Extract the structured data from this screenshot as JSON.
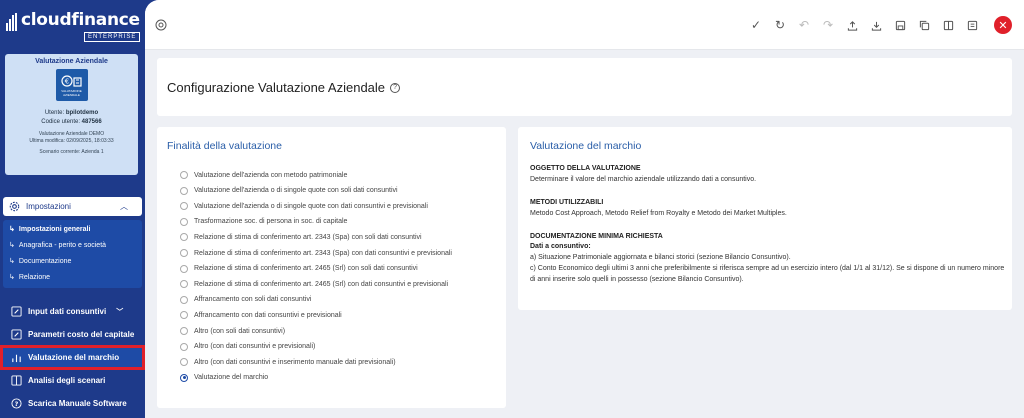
{
  "brand": {
    "name": "cloudfinance",
    "edition": "ENTERPRISE"
  },
  "card": {
    "title": "Valutazione Aziendale",
    "image_label": "VALUTAZIONE AZIENDALE",
    "user_label": "Utente:",
    "user_value": "bpilotdemo",
    "code_label": "Codice utente:",
    "code_value": "487566",
    "company": "Valutazione Aziendale DEMO",
    "last_modified": "Ultima modifica: 02/09/2025, 18:03:33",
    "scenario": "Scenario corrente: Azienda 1"
  },
  "sidebar": {
    "section": "Impostazioni",
    "sub_items": [
      {
        "label": "Impostazioni generali"
      },
      {
        "label": "Anagrafica - perito e società"
      },
      {
        "label": "Documentazione"
      },
      {
        "label": "Relazione"
      }
    ],
    "nav": [
      {
        "label": "Input dati consuntivi"
      },
      {
        "label": "Parametri costo del capitale"
      },
      {
        "label": "Valutazione del marchio"
      },
      {
        "label": "Analisi degli scenari"
      },
      {
        "label": "Scarica Manuale Software"
      }
    ]
  },
  "toolbar": {
    "left_icon": "lifebuoy-icon",
    "icons": [
      "check-icon",
      "refresh-icon",
      "undo-icon",
      "redo-icon",
      "upload-icon",
      "download-icon",
      "save-icon",
      "copy-icon",
      "columns-icon",
      "document-icon"
    ],
    "close_color": "#e0202a"
  },
  "page": {
    "title": "Configurazione Valutazione Aziendale"
  },
  "finalita": {
    "title": "Finalità della valutazione",
    "options": [
      {
        "label": "Valutazione dell'azienda con metodo patrimoniale",
        "selected": false
      },
      {
        "label": "Valutazione dell'azienda o di singole quote con soli dati consuntivi",
        "selected": false
      },
      {
        "label": "Valutazione dell'azienda o di singole quote con dati consuntivi e previsionali",
        "selected": false
      },
      {
        "label": "Trasformazione soc. di persona in soc. di capitale",
        "selected": false
      },
      {
        "label": "Relazione di stima di conferimento art. 2343 (Spa) con soli dati consuntivi",
        "selected": false
      },
      {
        "label": "Relazione di stima di conferimento art. 2343 (Spa) con dati consuntivi e previsionali",
        "selected": false
      },
      {
        "label": "Relazione di stima di conferimento art. 2465 (Srl) con soli dati consuntivi",
        "selected": false
      },
      {
        "label": "Relazione di stima di conferimento art. 2465 (Srl) con dati consuntivi e previsionali",
        "selected": false
      },
      {
        "label": "Affrancamento con soli dati consuntivi",
        "selected": false
      },
      {
        "label": "Affrancamento con dati consuntivi e previsionali",
        "selected": false
      },
      {
        "label": "Altro (con soli dati consuntivi)",
        "selected": false
      },
      {
        "label": "Altro (con dati consuntivi e previsionali)",
        "selected": false
      },
      {
        "label": "Altro (con dati consuntivi e inserimento manuale dati previsionali)",
        "selected": false
      },
      {
        "label": "Valutazione del marchio",
        "selected": true
      }
    ]
  },
  "marchio": {
    "title": "Valutazione del marchio",
    "oggetto_head": "OGGETTO DELLA VALUTAZIONE",
    "oggetto_text": "Determinare il valore del marchio aziendale utilizzando dati a consuntivo.",
    "metodi_head": "METODI UTILIZZABILI",
    "metodi_text": "Metodo Cost Approach, Metodo Relief from Royalty e Metodo dei Market Multiples.",
    "doc_head": "DOCUMENTAZIONE MINIMA RICHIESTA",
    "doc_sub": "Dati a consuntivo:",
    "doc_c1": "a) Situazione Patrimoniale aggiornata e bilanci storici (sezione Bilancio Consuntivo).",
    "doc_c2": "c) Conto Economico degli ultimi 3 anni che preferibilmente si riferisca sempre ad un esercizio intero (dal 1/1 al 31/12). Se si dispone di un numero minore di anni inserire solo quelli in possesso (sezione Bilancio Consuntivo)."
  }
}
